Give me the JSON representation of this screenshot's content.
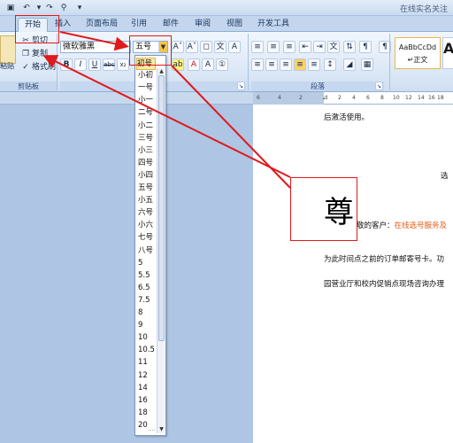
{
  "title_bar": {
    "doc_title": "在线实名关注",
    "quick_access": [
      "save-icon",
      "undo-icon",
      "redo-icon",
      "print-preview-icon",
      "customize-icon"
    ]
  },
  "tabs": [
    "开始",
    "插入",
    "页面布局",
    "引用",
    "邮件",
    "审阅",
    "视图",
    "开发工具"
  ],
  "ribbon": {
    "clipboard": {
      "paste": "粘贴",
      "cut": "剪切",
      "copy": "复制",
      "format_painter": "格式刷",
      "label": "剪贴板"
    },
    "font": {
      "name": "微软雅黑",
      "size": "五号"
    },
    "paragraph": {
      "label": "段落"
    },
    "styles": {
      "style1_preview": "AaBbCcDd",
      "style1_name": "↵正文",
      "style2_preview": "A"
    }
  },
  "font_size_dropdown": {
    "items": [
      "初号",
      "小初",
      "一号",
      "小一",
      "二号",
      "小二",
      "三号",
      "小三",
      "四号",
      "小四",
      "五号",
      "小五",
      "六号",
      "小六",
      "七号",
      "八号",
      "5",
      "5.5",
      "6.5",
      "7.5",
      "8",
      "9",
      "10",
      "10.5",
      "11",
      "12",
      "14",
      "16",
      "18",
      "20"
    ],
    "grip": "····"
  },
  "ruler": {
    "marks": [
      "6",
      "4",
      "2",
      "",
      "2",
      "4",
      "6",
      "8",
      "10",
      "12",
      "14",
      "16",
      "18",
      "20"
    ]
  },
  "document": {
    "line1": "后激活使用。",
    "line2": "选",
    "big_char": "尊",
    "line3_prefix": "敬的客户：",
    "line3_highlight": "在线选号服务及",
    "line4": "为此时间点之前的订单邮寄号卡。功",
    "line5": "园营业厅和校内促销点现场咨询办理"
  },
  "colors": {
    "annotation": "#e0191b",
    "highlight_text": "#e0601c",
    "ribbon": "#dbe7f6",
    "app_background": "#aec6e4"
  }
}
